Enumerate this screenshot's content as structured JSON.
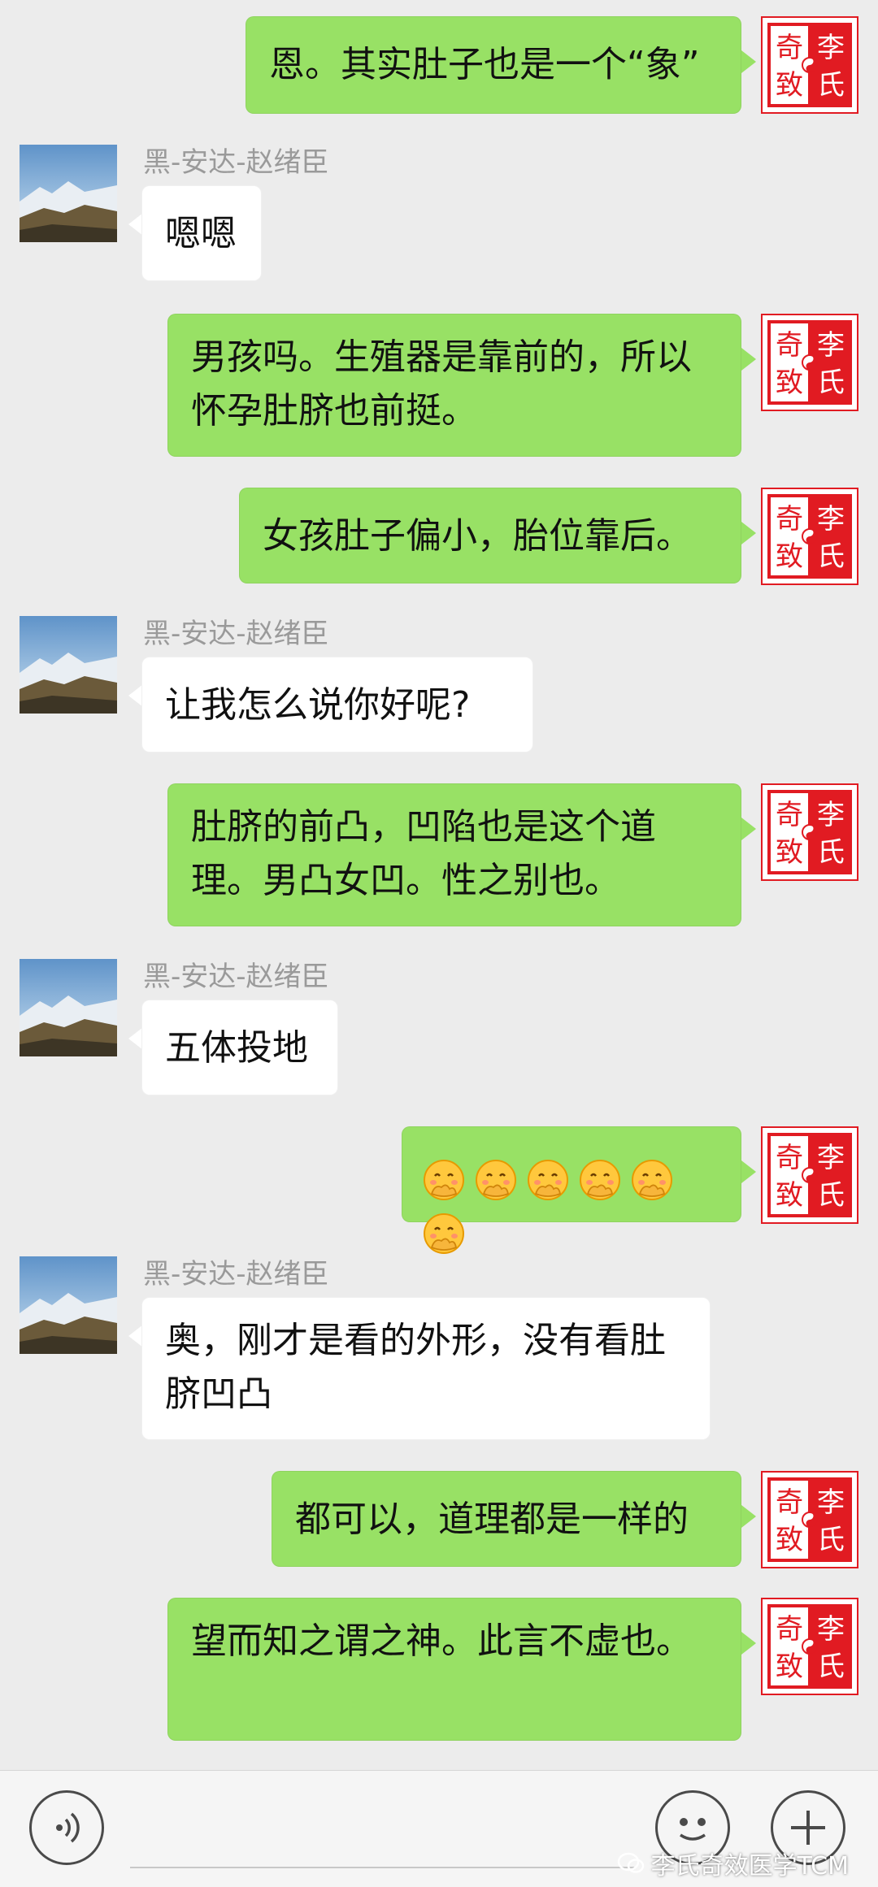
{
  "sender_name": "黑-安达-赵绪臣",
  "seal_chars": [
    "奇",
    "李",
    "致",
    "氏"
  ],
  "messages": [
    {
      "text": "恩。其实肚子也是一个“象”"
    },
    {
      "text": "嗯嗯"
    },
    {
      "text": "男孩吗。生殖器是靠前的，所以怀孕肚脐也前挺。"
    },
    {
      "text": "女孩肚子偏小，胎位靠后。"
    },
    {
      "text": "让我怎么说你好呢?"
    },
    {
      "text": "肚脐的前凸，凹陷也是这个道理。男凸女凹。性之别也。"
    },
    {
      "text": "五体投地"
    },
    {
      "emoji_icon": "covering-mouth-emoji",
      "emoji_count": 6
    },
    {
      "text": "奥，刚才是看的外形，没有看肚脐凹凸"
    },
    {
      "text": "都可以，道理都是一样的"
    },
    {
      "text": "望而知之谓之神。此言不虚也。"
    }
  ],
  "watermark": "李氏奇效医学TCM",
  "icons": {
    "voice": "voice-icon",
    "emoji": "emoji-smile-icon",
    "plus": "plus-icon"
  },
  "colors": {
    "bubble_me": "#98e165",
    "bubble_them": "#ffffff",
    "seal_red": "#e11b22",
    "background": "#ececec"
  }
}
